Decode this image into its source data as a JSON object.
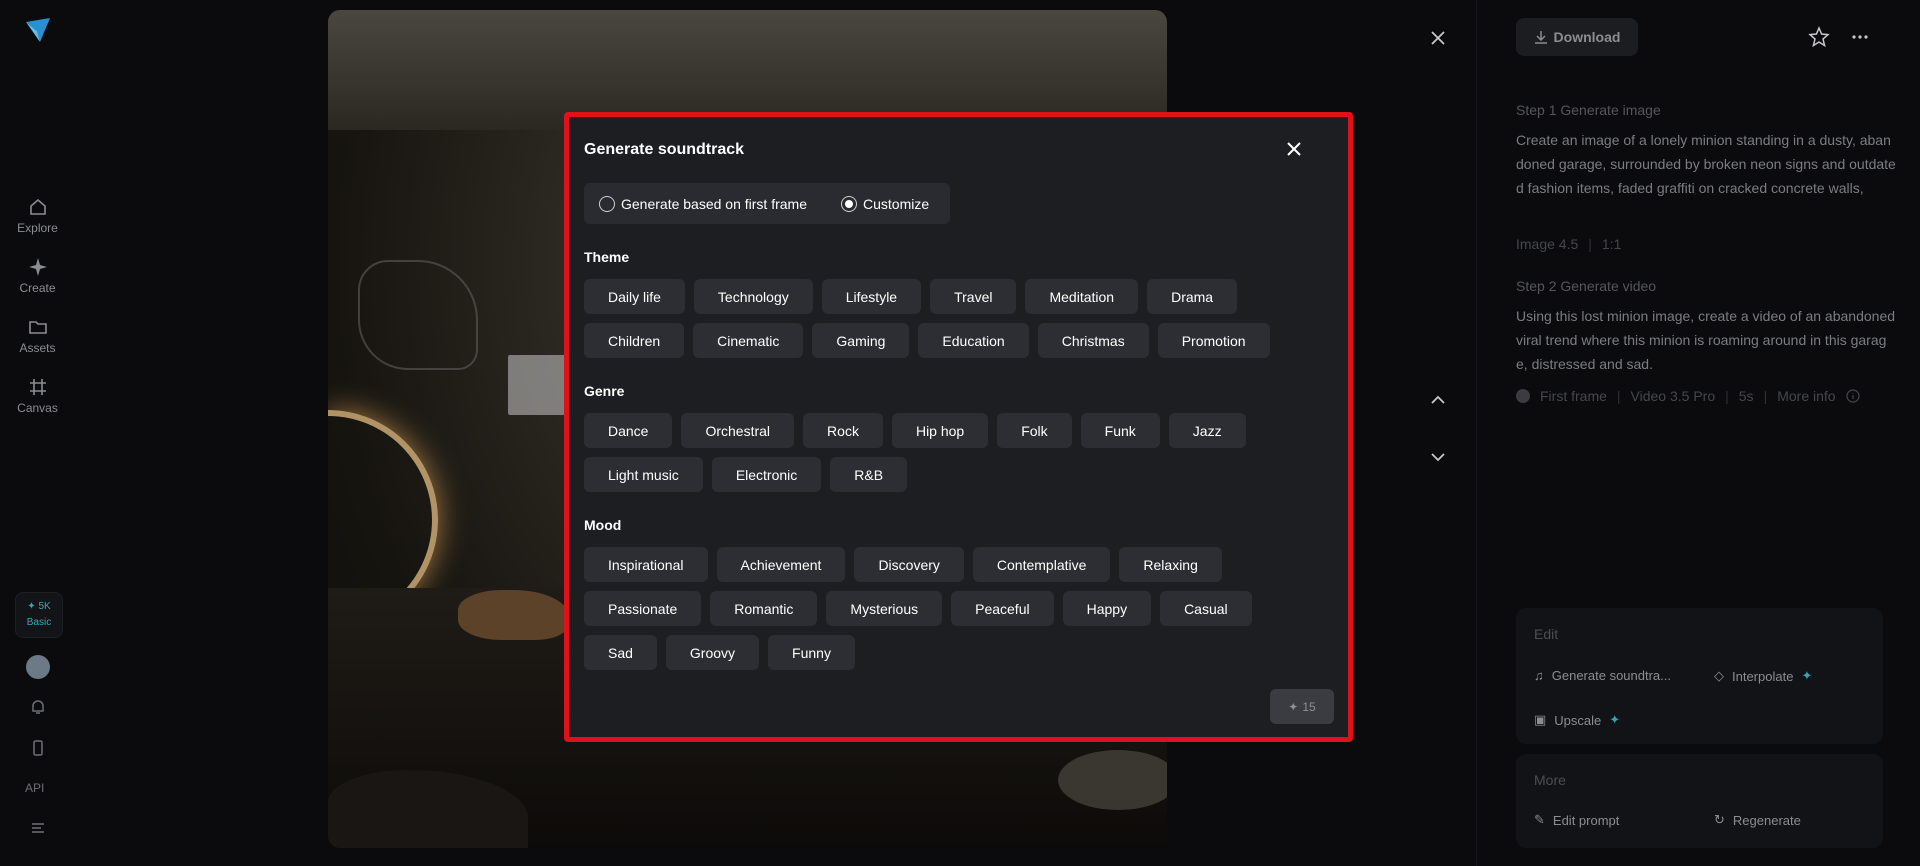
{
  "leftnav": {
    "items": [
      {
        "label": "Explore",
        "icon": "home-icon"
      },
      {
        "label": "Create",
        "icon": "sparkle-icon"
      },
      {
        "label": "Assets",
        "icon": "folder-icon"
      },
      {
        "label": "Canvas",
        "icon": "frame-icon"
      }
    ],
    "credits": {
      "amount": "5K",
      "plan": "Basic"
    },
    "api_label": "API"
  },
  "rightpanel": {
    "download_label": "Download",
    "step1": {
      "title": "Step 1 Generate image",
      "text": "Create an image of a lonely minion standing in a dusty, abandoned garage, surrounded by broken neon signs and outdated fashion items, faded graffiti on cracked concrete walls,",
      "model": "Image 4.5",
      "ratio": "1:1"
    },
    "step2": {
      "title": "Step 2 Generate video",
      "text": "Using this lost minion image, create a video of an abandoned viral trend where this minion is roaming around in this garage, distressed and sad.",
      "frame": "First frame",
      "model": "Video 3.5 Pro",
      "duration": "5s",
      "more_info": "More info"
    },
    "edit_card": {
      "title": "Edit",
      "generate_soundtrack": "Generate soundtra...",
      "interpolate": "Interpolate",
      "upscale": "Upscale"
    },
    "more_card": {
      "title": "More",
      "edit_prompt": "Edit prompt",
      "regenerate": "Regenerate"
    }
  },
  "modal": {
    "title": "Generate soundtrack",
    "options": {
      "first_frame": "Generate based on first frame",
      "customize": "Customize",
      "selected": "Customize"
    },
    "theme_label": "Theme",
    "theme_row1": [
      "Daily life",
      "Technology",
      "Lifestyle",
      "Travel",
      "Meditation",
      "Drama"
    ],
    "theme_row2": [
      "Children",
      "Cinematic",
      "Gaming",
      "Education",
      "Christmas",
      "Promotion"
    ],
    "genre_label": "Genre",
    "genre_row1": [
      "Dance",
      "Orchestral",
      "Rock",
      "Hip hop",
      "Folk",
      "Funk",
      "Jazz"
    ],
    "genre_row2": [
      "Light music",
      "Electronic",
      "R&B"
    ],
    "mood_label": "Mood",
    "mood_row1": [
      "Inspirational",
      "Achievement",
      "Discovery",
      "Contemplative",
      "Relaxing"
    ],
    "mood_row2": [
      "Passionate",
      "Romantic",
      "Mysterious",
      "Peaceful",
      "Happy",
      "Casual"
    ],
    "mood_row3": [
      "Sad",
      "Groovy",
      "Funny"
    ],
    "cost": "15"
  },
  "colors": {
    "accent_teal": "#2aa6b6",
    "highlight_border": "#e0111a",
    "modal_bg": "#1c1e22",
    "chip_bg": "#2c2e33"
  }
}
